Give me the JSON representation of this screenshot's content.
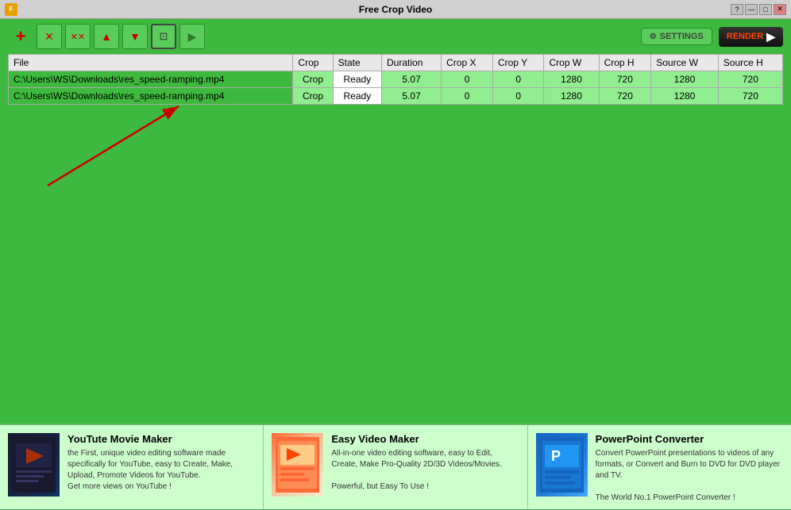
{
  "titleBar": {
    "title": "Free Crop Video",
    "controls": [
      "?",
      "—",
      "□",
      "✕"
    ]
  },
  "toolbar": {
    "addLabel": "+",
    "buttons": [
      "✕",
      "✕✕",
      "↑",
      "↓",
      "⊡",
      "▶"
    ]
  },
  "rightButtons": {
    "settingsLabel": "SETTINGS",
    "renderLabel": "RENDER"
  },
  "table": {
    "headers": [
      "File",
      "Crop",
      "State",
      "Duration",
      "Crop X",
      "Crop Y",
      "Crop W",
      "Crop H",
      "Source W",
      "Source H"
    ],
    "rows": [
      {
        "file": "C:\\Users\\WS\\Downloads\\res_speed-ramping.mp4",
        "crop": "Crop",
        "state": "Ready",
        "duration": "5.07",
        "cropX": "0",
        "cropY": "0",
        "cropW": "1280",
        "cropH": "720",
        "sourceW": "1280",
        "sourceH": "720"
      },
      {
        "file": "C:\\Users\\WS\\Downloads\\res_speed-ramping.mp4",
        "crop": "Crop",
        "state": "Ready",
        "duration": "5.07",
        "cropX": "0",
        "cropY": "0",
        "cropW": "1280",
        "cropH": "720",
        "sourceW": "1280",
        "sourceH": "720"
      }
    ]
  },
  "ads": [
    {
      "title": "YouTute Movie Maker",
      "text": "the First, unique video editing software made specifically for YouTube, easy to Create, Make, Upload, Promote Videos for YouTube.\nGet more views on YouTube !"
    },
    {
      "title": "Easy Video Maker",
      "text": "All-in-one video editing software, easy to Edit, Create, Make Pro-Quality 2D/3D Videos/Movies.\n\nPowerful, but Easy To Use !"
    },
    {
      "title": "PowerPoint Converter",
      "text": "Convert PowerPoint presentations to videos of any formats, or Convert and Burn to DVD for DVD player and TV.\n\nThe World No.1 PowerPoint Converter !"
    }
  ]
}
